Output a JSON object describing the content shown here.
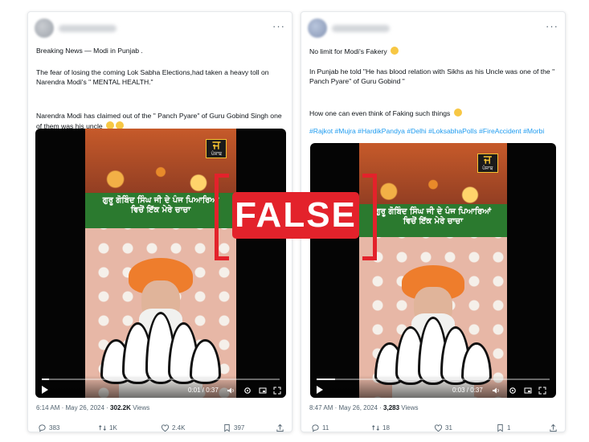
{
  "colors": {
    "false_red": "#e3222b",
    "hashtag_blue": "#1d9bf0",
    "banner_green": "#2b7a2f",
    "turban_orange": "#ee7d2c"
  },
  "stamp": {
    "label": "FALSE"
  },
  "left_tweet": {
    "line1": "Breaking News  — Modi in Punjab .",
    "line2": "The fear of losing the coming Lok Sabha Elections,had taken a heavy toll on Narendra Modi's \" MENTAL HEALTH.\"",
    "line3": "Narendra Modi has claimed out of the  \" Panch Pyare\" of Guru Gobind Singh one  of them was his uncle",
    "video": {
      "banner_line1": "ਗੁਰੂ ਗੋਬਿੰਦ ਸਿੰਘ ਜੀ ਦੇ ਪੰਜ ਪਿਆਰਿਆਂ",
      "banner_line2": "ਵਿਚੋਂ ਇੱਕ ਮੇਰੇ ਚਾਚਾ",
      "channel_mark": "ਜ",
      "channel_sub": "ਪੰਜਾਬ",
      "time": "0:01 / 0:37",
      "progress": 0.03
    },
    "time": "6:14 AM · May 26, 2024 · ",
    "views_count": "302.2K",
    "views_label": " Views",
    "replies": "383",
    "retweets": "1K",
    "likes": "2.4K",
    "bookmarks": "397"
  },
  "right_tweet": {
    "line1": "No limit for Modi's Fakery",
    "line2": "In Punjab he told \"He has blood relation with Sikhs as his Uncle was one of the \" Panch Pyare\" of Guru Gobind \"",
    "line3": "How one can even think of Faking such things",
    "hashtags": "#Rajkot #Mujra #HardikPandya #Delhi #LoksabhaPolls #FireAccident #Morbi",
    "video": {
      "banner_line1": "ਗੁਰੂ ਗੋਬਿੰਦ ਸਿੰਘ ਜੀ ਦੇ ਪੰਜ ਪਿਆਰਿਆਂ",
      "banner_line2": "ਵਿਚੋਂ ਇੱਕ ਮੇਰੇ ਚਾਚਾ",
      "channel_mark": "ਜ",
      "channel_sub": "ਪੰਜਾਬ",
      "time": "0:03 / 0:37",
      "progress": 0.08
    },
    "time": "8:47 AM · May 26, 2024 · ",
    "views_count": "3,283",
    "views_label": " Views",
    "replies": "11",
    "retweets": "18",
    "likes": "31",
    "bookmarks": "1"
  }
}
